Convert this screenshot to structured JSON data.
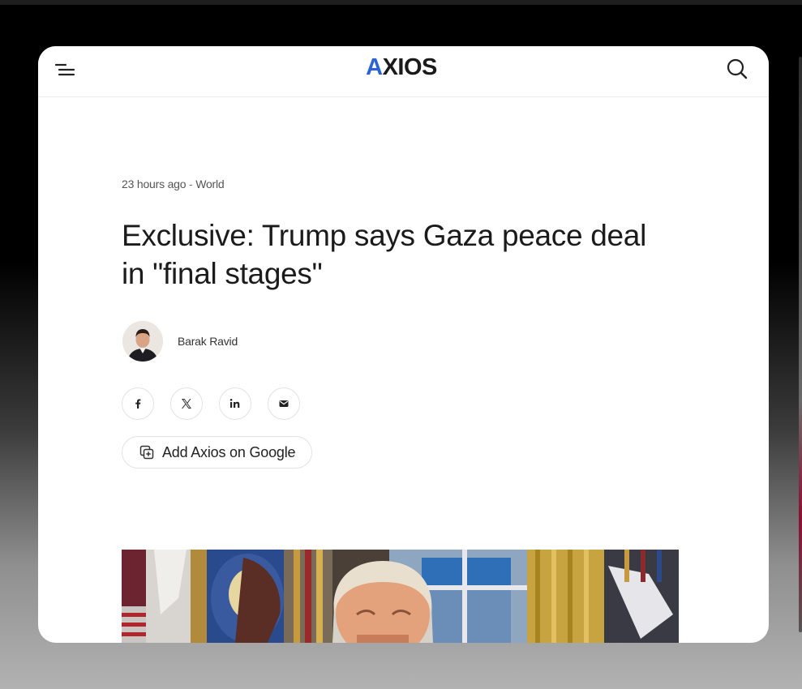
{
  "header": {
    "logo_text": "XIOS",
    "logo_prefix": "A"
  },
  "article": {
    "time": "23 hours ago",
    "separator": " - ",
    "section": "World",
    "headline": "Exclusive: Trump says Gaza peace deal in \"final stages\"",
    "author": "Barak Ravid"
  },
  "share": {
    "items": [
      "facebook-icon",
      "x-icon",
      "linkedin-icon",
      "email-icon"
    ]
  },
  "google_button": {
    "label": "Add Axios on Google"
  },
  "colors": {
    "brand_blue": "#2a63d6",
    "text": "#1b1b1b"
  }
}
